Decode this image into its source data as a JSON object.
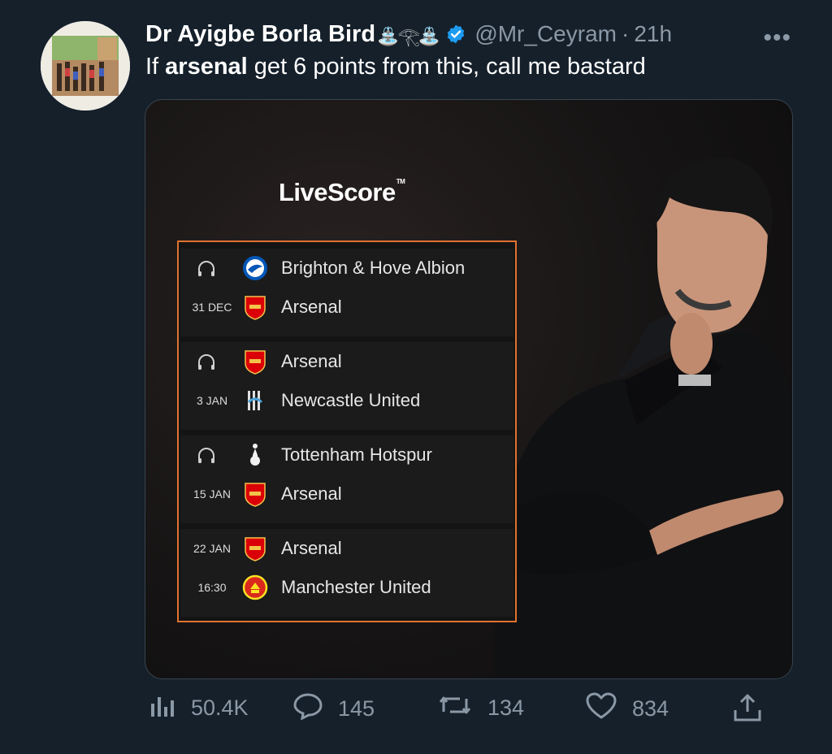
{
  "tweet": {
    "display_name": "Dr Ayigbe Borla Bird",
    "name_emoji": "⛲𓂀⛲",
    "handle": "@Mr_Ceyram",
    "separator": "·",
    "time": "21h",
    "more": "•••",
    "text_before": "If ",
    "text_bold": "arsenal",
    "text_after": " get 6 points from this, call me bastard"
  },
  "media": {
    "brand": "LiveScore",
    "brand_tm": "TM",
    "fixtures": [
      {
        "date": "31 DEC",
        "time": "",
        "home": "Brighton & Hove Albion",
        "away": "Arsenal",
        "home_crest": "brighton-crest",
        "away_crest": "arsenal-crest"
      },
      {
        "date": "3 JAN",
        "time": "",
        "home": "Arsenal",
        "away": "Newcastle United",
        "home_crest": "arsenal-crest",
        "away_crest": "newcastle-crest"
      },
      {
        "date": "15 JAN",
        "time": "",
        "home": "Tottenham Hotspur",
        "away": "Arsenal",
        "home_crest": "tottenham-crest",
        "away_crest": "arsenal-crest"
      },
      {
        "date": "22 JAN",
        "time": "16:30",
        "home": "Arsenal",
        "away": "Manchester United",
        "home_crest": "arsenal-crest",
        "away_crest": "manchester-united-crest"
      }
    ],
    "colors": {
      "border": "#e0722f",
      "arsenal": "#db0007",
      "brighton": "#0057b8"
    }
  },
  "actions": {
    "views": "50.4K",
    "replies": "145",
    "retweets": "134",
    "likes": "834"
  },
  "colors": {
    "background": "#15202b",
    "muted": "#8b98a5",
    "verified": "#1d9bf0"
  }
}
